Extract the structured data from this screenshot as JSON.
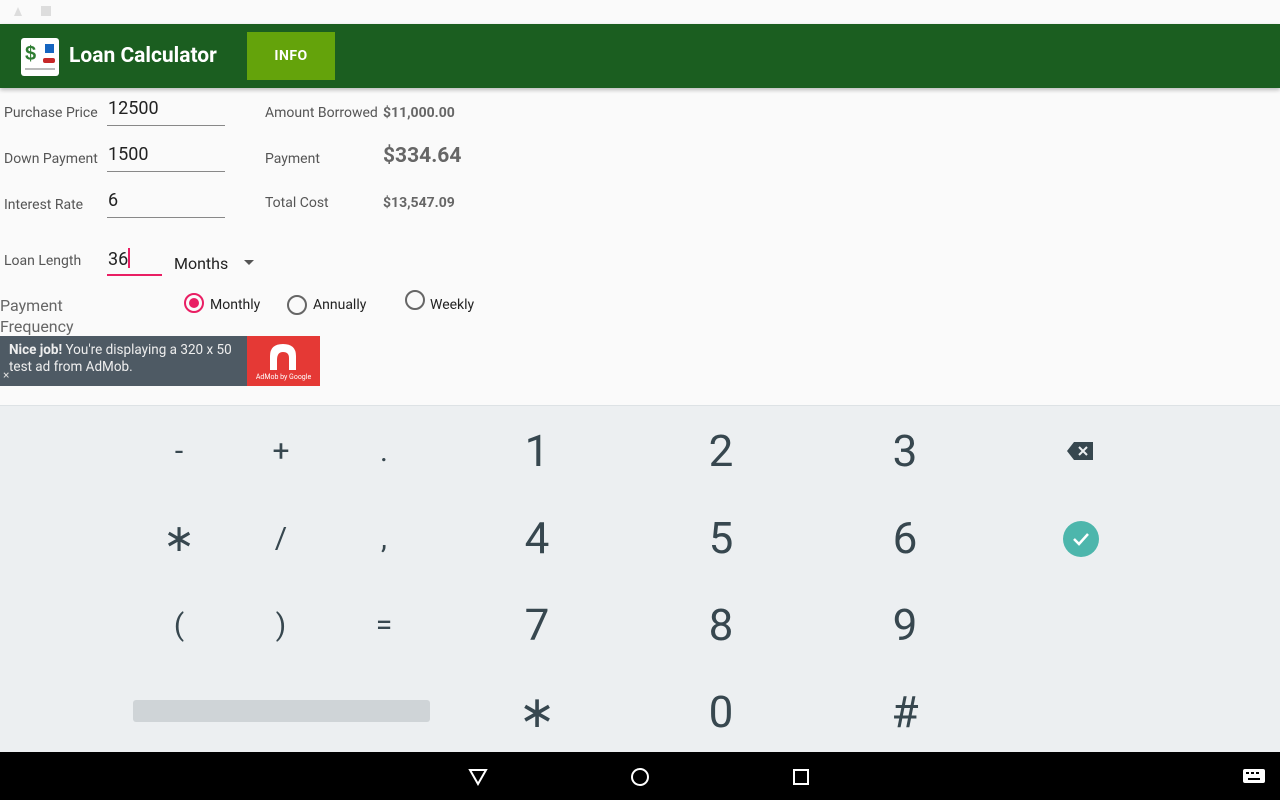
{
  "app": {
    "title": "Loan Calculator",
    "info_button": "INFO"
  },
  "form": {
    "purchase_price": {
      "label": "Purchase Price",
      "value": "12500"
    },
    "down_payment": {
      "label": "Down Payment",
      "value": "1500"
    },
    "interest_rate": {
      "label": "Interest Rate",
      "value": "6"
    },
    "loan_length": {
      "label": "Loan Length",
      "value": "36",
      "unit_selected": "Months"
    }
  },
  "results": {
    "amount_borrowed": {
      "label": "Amount Borrowed",
      "value": "$11,000.00"
    },
    "payment": {
      "label": "Payment",
      "value": "$334.64"
    },
    "total_cost": {
      "label": "Total Cost",
      "value": "$13,547.09"
    }
  },
  "frequency": {
    "label": "Payment Frequency",
    "options": [
      "Monthly",
      "Annually",
      "Weekly"
    ],
    "selected": "Monthly"
  },
  "ad": {
    "bold": "Nice job!",
    "text": " You're displaying a 320 x 50 test ad from AdMob.",
    "logo_text": "AdMob by Google",
    "close": "×"
  },
  "keyboard": {
    "rows": [
      [
        "-",
        "+",
        ".",
        "1",
        "2",
        "3"
      ],
      [
        "∗",
        "/",
        ",",
        "4",
        "5",
        "6"
      ],
      [
        "(",
        ")",
        "=",
        "7",
        "8",
        "9"
      ],
      [
        "∗",
        "0",
        "#"
      ]
    ]
  },
  "colors": {
    "appbar": "#1b5e20",
    "info_button": "#64a30b",
    "accent": "#e91e63",
    "ok_key": "#4db6ac"
  }
}
